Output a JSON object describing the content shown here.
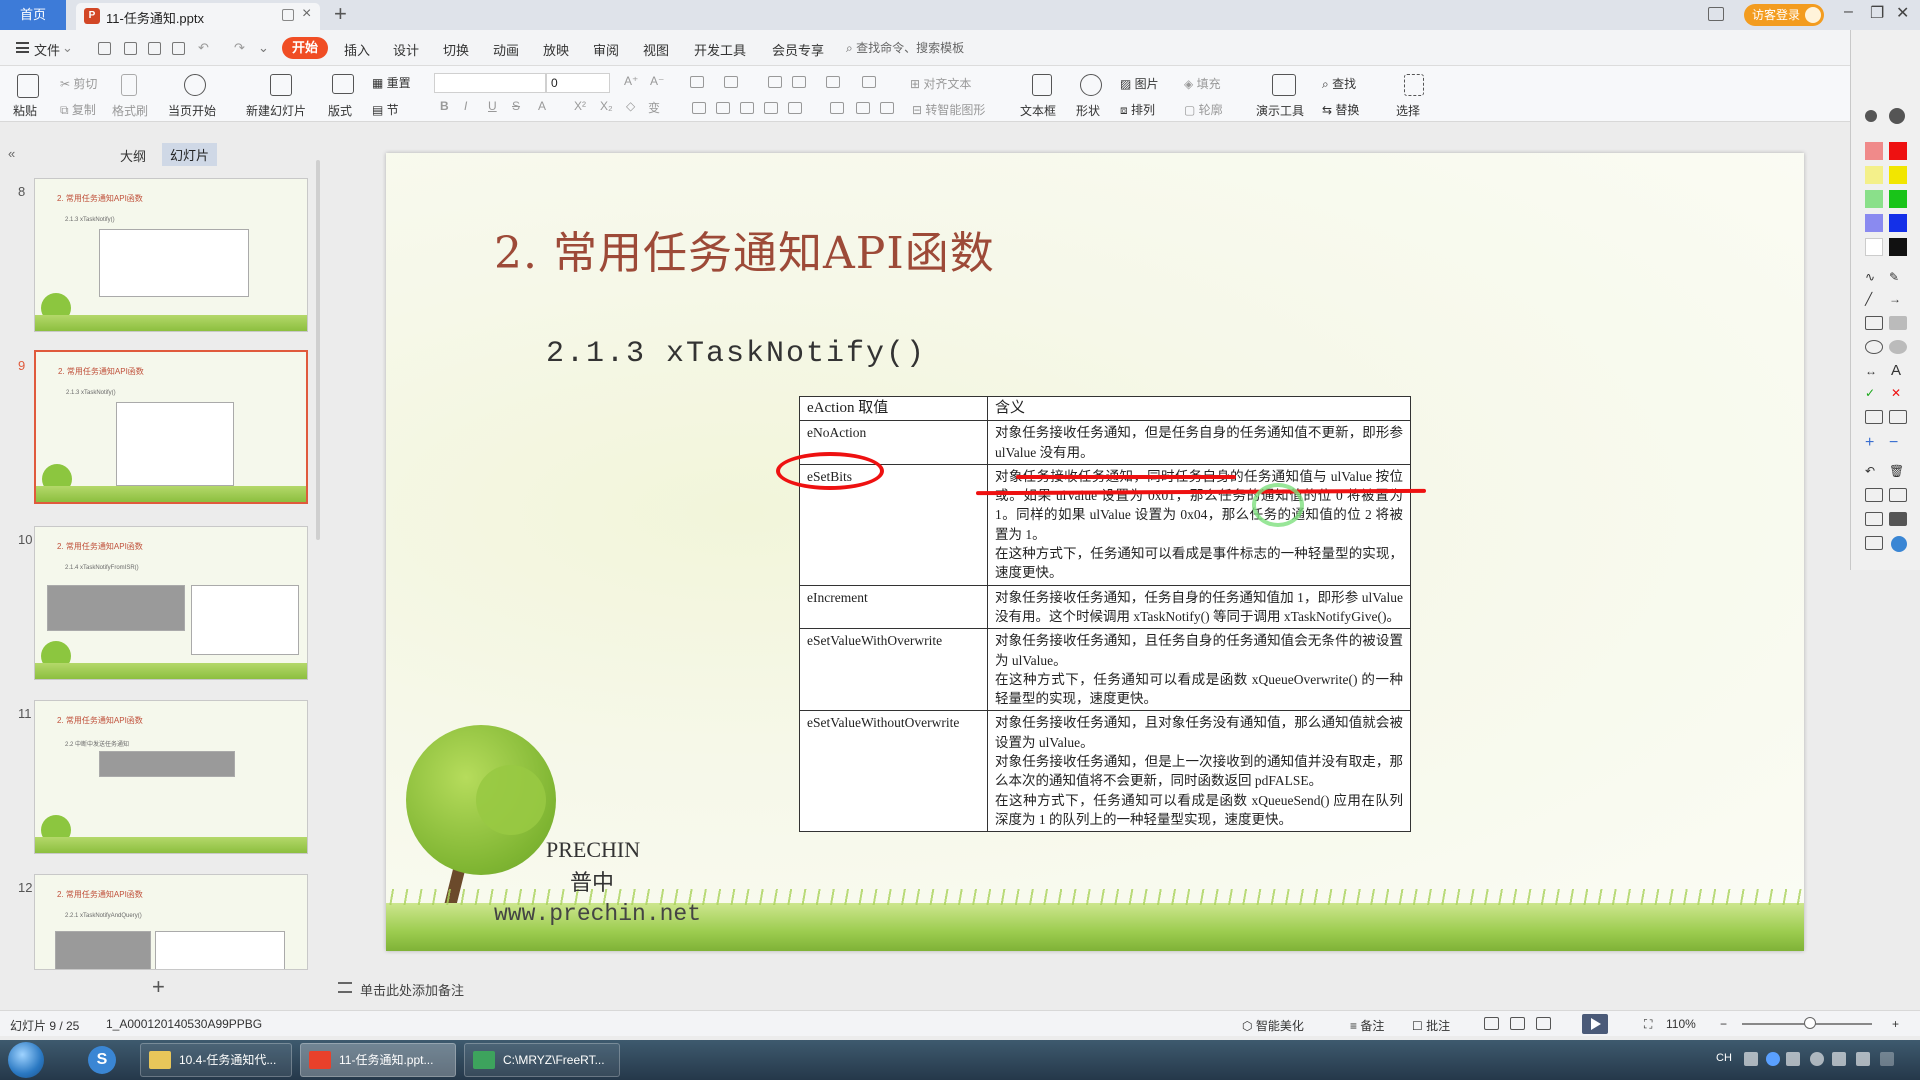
{
  "titlebar": {
    "home_tab": "首页",
    "doc_tab": "11-任务通知.pptx",
    "doc_badge": "P",
    "visitor_login": "访客登录"
  },
  "menu": {
    "file": "文件",
    "tabs": [
      "开始",
      "插入",
      "设计",
      "切换",
      "动画",
      "放映",
      "审阅",
      "视图",
      "开发工具",
      "会员专享"
    ],
    "search_placeholder": "查找命令、搜索模板"
  },
  "ribbon": {
    "paste": "粘贴",
    "cut": "剪切",
    "copy": "复制",
    "format_painter": "格式刷",
    "start_from_current": "当页开始",
    "new_slide": "新建幻灯片",
    "layout": "版式",
    "section": "节",
    "reset": "重置",
    "font_size": "0",
    "align_text": "对齐文本",
    "convert_smartart": "转智能图形",
    "textbox": "文本框",
    "shape": "形状",
    "picture": "图片",
    "fill": "填充",
    "arrange": "排列",
    "outline": "轮廓",
    "presentation_tools": "演示工具",
    "find": "查找",
    "replace": "替换",
    "select": "选择"
  },
  "leftpane": {
    "tab_outline": "大纲",
    "tab_slides": "幻灯片",
    "thumbnails": [
      {
        "num": "8",
        "title": "2. 常用任务通知API函数",
        "sub": "2.1.3 xTaskNotify()"
      },
      {
        "num": "9",
        "title": "2. 常用任务通知API函数",
        "sub": "2.1.3 xTaskNotify()"
      },
      {
        "num": "10",
        "title": "2. 常用任务通知API函数",
        "sub": "2.1.4 xTaskNotifyFromISR()"
      },
      {
        "num": "11",
        "title": "2. 常用任务通知API函数",
        "sub": "2.2 中断中发送任务通知"
      },
      {
        "num": "12",
        "title": "2. 常用任务通知API函数",
        "sub": "2.2.1 xTaskNotifyAndQuery()"
      }
    ]
  },
  "slide": {
    "title": "2. 常用任务通知API函数",
    "subtitle": "2.1.3 xTaskNotify()",
    "table": {
      "headers": [
        "eAction 取值",
        "含义"
      ],
      "rows": [
        {
          "key": "eNoAction",
          "lines": [
            "对象任务接收任务通知，但是任务自身的任务通知值不更新，即形参 ulValue 没有用。"
          ]
        },
        {
          "key": "eSetBits",
          "lines": [
            "对象任务接收任务通知，同时任务自身的任务通知值与 ulValue 按位或。如果 ulValue 设置为 0x01，那么任务的通知值的位 0 将被置为 1。同样的如果 ulValue 设置为 0x04，那么任务的通知值的位 2 将被置为 1。",
            "在这种方式下，任务通知可以看成是事件标志的一种轻量型的实现，速度更快。"
          ]
        },
        {
          "key": "eIncrement",
          "lines": [
            "对象任务接收任务通知，任务自身的任务通知值加 1，即形参 ulValue 没有用。这个时候调用 xTaskNotify() 等同于调用 xTaskNotifyGive()。"
          ]
        },
        {
          "key": "eSetValueWithOverwrite",
          "lines": [
            "对象任务接收任务通知，且任务自身的任务通知值会无条件的被设置为 ulValue。",
            "在这种方式下，任务通知可以看成是函数 xQueueOverwrite() 的一种轻量型的实现，速度更快。"
          ]
        },
        {
          "key": "eSetValueWithoutOverwrite",
          "lines": [
            "对象任务接收任务通知，且对象任务没有通知值，那么通知值就会被设置为 ulValue。",
            "对象任务接收任务通知，但是上一次接收到的通知值并没有取走，那么本次的通知值将不会更新，同时函数返回 pdFALSE。",
            "在这种方式下，任务通知可以看成是函数 xQueueSend() 应用在队列深度为 1 的队列上的一种轻量型实现，速度更快。"
          ]
        }
      ]
    },
    "logo_en": "PRECHIN",
    "logo_cn": "普中",
    "logo_url": "www.prechin.net"
  },
  "notes": {
    "placeholder": "单击此处添加备注"
  },
  "status": {
    "slide_count": "幻灯片 9 / 25",
    "theme": "1_A000120140530A99PPBG",
    "beautify": "智能美化",
    "notes": "备注",
    "comments": "批注",
    "zoom": "110%",
    "zoom_level": 0.52
  },
  "taskbar": {
    "items": [
      "10.4-任务通知代...",
      "11-任务通知.ppt...",
      "C:\\MRYZ\\FreeRT..."
    ],
    "tray_lang": "CH"
  },
  "colors": {
    "accent_start": "#f04d24",
    "title_red": "#9d4a38",
    "annotation_red": "#ee1111",
    "annotation_green": "#7ee07e"
  }
}
